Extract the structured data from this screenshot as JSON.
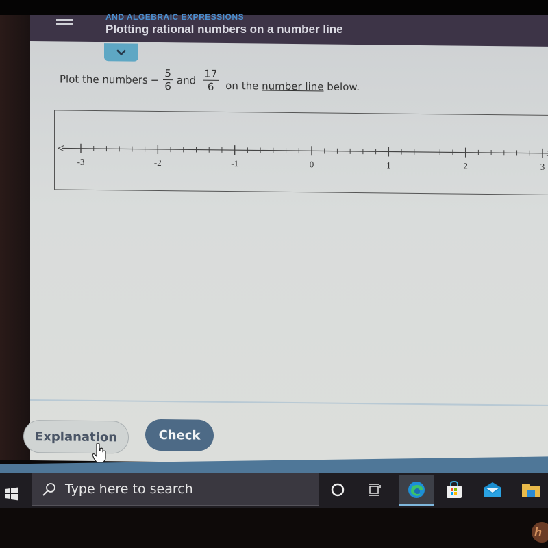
{
  "header": {
    "breadcrumb": "AND ALGEBRAIC EXPRESSIONS",
    "title": "Plotting rational numbers on a number line"
  },
  "question": {
    "prefix": "Plot the numbers",
    "first_number": {
      "sign": "−",
      "numerator": "5",
      "denominator": "6"
    },
    "conjunction": "and",
    "second_number": {
      "numerator": "17",
      "denominator": "6"
    },
    "suffix_before_link": "on the",
    "link_text": "number line",
    "suffix_after_link": "below."
  },
  "number_line": {
    "min": -3,
    "max": 3,
    "subdivisions_per_unit": 6,
    "labels": [
      "-3",
      "-2",
      "-1",
      "0",
      "1",
      "2",
      "3"
    ],
    "plotted_points": []
  },
  "buttons": {
    "explanation": "Explanation",
    "check": "Check"
  },
  "colors": {
    "header_bg": "#3d3447",
    "accent_tab": "#5ea7c4",
    "check_button": "#4d6a86"
  },
  "taskbar": {
    "search_placeholder": "Type here to search",
    "icons": [
      "windows-start-icon",
      "cortana-icon",
      "task-view-icon",
      "edge-icon",
      "store-icon",
      "mail-icon",
      "file-explorer-icon"
    ]
  }
}
